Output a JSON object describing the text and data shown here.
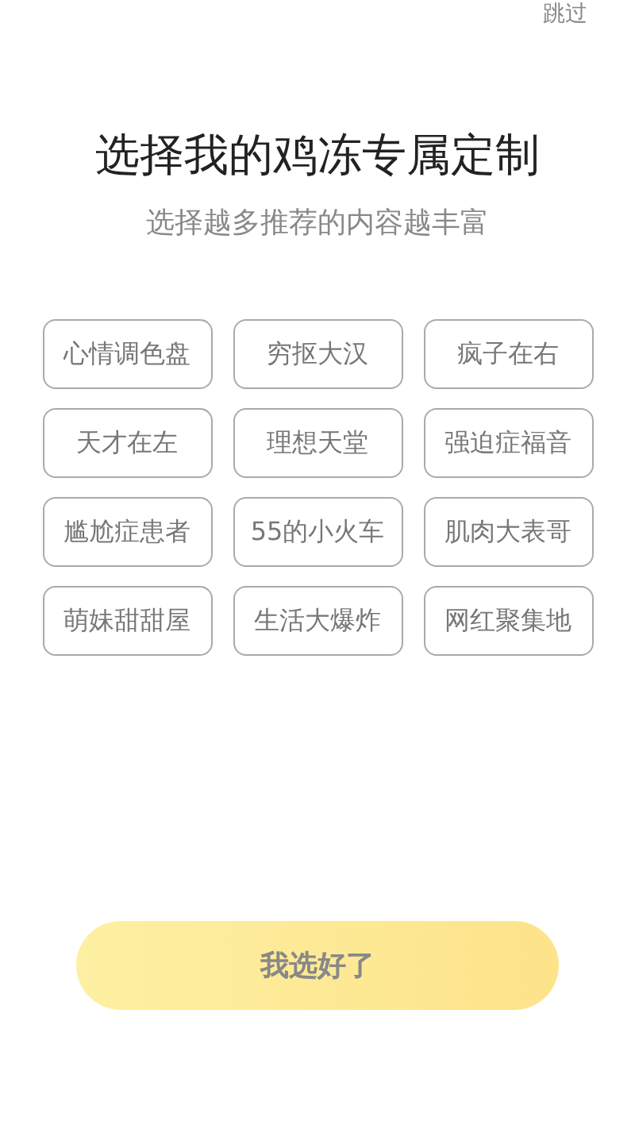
{
  "skip_link": "跳过",
  "title": "选择我的鸡冻专属定制",
  "subtitle": "选择越多推荐的内容越丰富",
  "tags": [
    {
      "label": "心情调色盘"
    },
    {
      "label": "穷抠大汉"
    },
    {
      "label": "疯子在右"
    },
    {
      "label": "天才在左"
    },
    {
      "label": "理想天堂"
    },
    {
      "label": "强迫症福音"
    },
    {
      "label": "尴尬症患者"
    },
    {
      "label": "55的小火车"
    },
    {
      "label": "肌肉大表哥"
    },
    {
      "label": "萌妹甜甜屋"
    },
    {
      "label": "生活大爆炸"
    },
    {
      "label": "网红聚集地"
    }
  ],
  "confirm_button": "我选好了"
}
